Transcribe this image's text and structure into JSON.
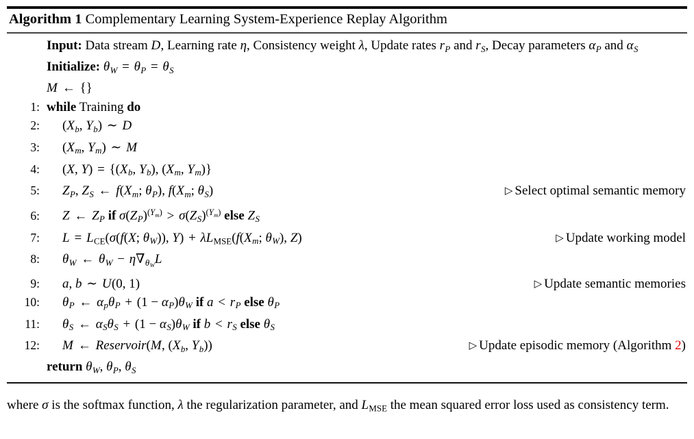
{
  "algorithm": {
    "label": "Algorithm 1",
    "title": "Complementary Learning System-Experience Replay Algorithm",
    "input_label": "Input:",
    "input_text_a": "Data stream",
    "input_text_b": ", Learning rate",
    "input_text_c": ", Consistency weight",
    "input_text_d": ", Update rates",
    "input_text_e": "and",
    "input_text_f": ", Decay parameters",
    "input_text_g": "and",
    "initialize_label": "Initialize:",
    "return_label": "return",
    "symbols": {
      "data_stream": "D",
      "learning_rate": "η",
      "consistency_weight": "λ",
      "rate_p": "r",
      "rate_s": "r",
      "alpha": "α",
      "theta": "θ",
      "memory": "M",
      "empty_set": "{}",
      "assign": "←",
      "sample": "∼",
      "equals": "=",
      "greater": ">",
      "less": "<",
      "plus": "+",
      "minus": "−",
      "nabla": "∇",
      "sigma": "σ",
      "uniform": "U",
      "comment_marker": "▷"
    },
    "keywords": {
      "while": "while",
      "training": "Training",
      "do": "do",
      "if": "if",
      "else": "else"
    },
    "lines": [
      {
        "n": "1:",
        "comment": ""
      },
      {
        "n": "2:",
        "comment": ""
      },
      {
        "n": "3:",
        "comment": ""
      },
      {
        "n": "4:",
        "comment": ""
      },
      {
        "n": "5:",
        "comment": "Select optimal semantic memory"
      },
      {
        "n": "6:",
        "comment": ""
      },
      {
        "n": "7:",
        "comment": "Update working model"
      },
      {
        "n": "8:",
        "comment": ""
      },
      {
        "n": "9:",
        "comment": "Update semantic memories"
      },
      {
        "n": "10:",
        "comment": ""
      },
      {
        "n": "11:",
        "comment": ""
      },
      {
        "n": "12:",
        "comment": "Update episodic memory (Algorithm "
      }
    ],
    "comment_algo_ref": "2",
    "comment_algo_close": ")",
    "func": "f",
    "loss": "L",
    "loss_ce": "CE",
    "loss_mse": "MSE",
    "reservoir": "Reservoir"
  },
  "caption": {
    "part1": "where ",
    "sigma": "σ",
    "part2": " is the softmax function, ",
    "lambda": "λ",
    "part3": " the regularization parameter, and ",
    "loss": "L",
    "loss_sub": "MSE",
    "part4": " the mean squared error loss used as consistency term."
  }
}
